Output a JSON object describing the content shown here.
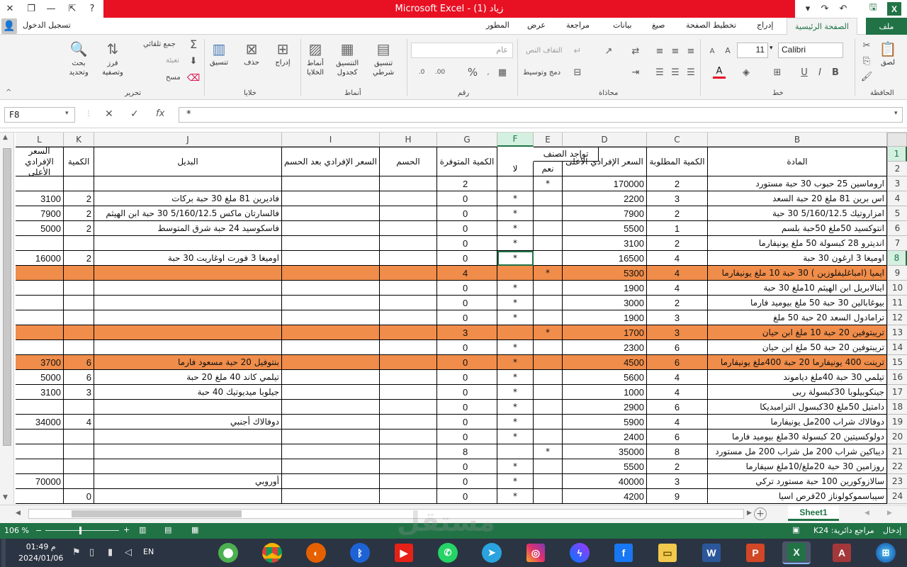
{
  "window": {
    "title": "زياد (1)  -  Microsoft Excel",
    "signin": "تسجيل الدخول"
  },
  "colors": {
    "excel_green": "#217346",
    "title_red": "#e81123",
    "orange_row": "#f08d4a",
    "selection": "#217346"
  },
  "tabs": [
    "ملف",
    "الصفحة الرئيسية",
    "إدراج",
    "تخطيط الصفحة",
    "صيغ",
    "بيانات",
    "مراجعة",
    "عرض",
    "المطور"
  ],
  "ribbon": {
    "clipboard": {
      "group": "الحافظة",
      "paste": "لصق"
    },
    "font": {
      "group": "خط",
      "name": "Calibri",
      "size": "11"
    },
    "alignment": {
      "group": "محاذاة",
      "wrap": "التفاف النص",
      "merge": "دمج وتوسيط"
    },
    "number": {
      "group": "رقم",
      "format": "عام"
    },
    "styles": {
      "group": "أنماط",
      "conditional": "تنسيق\nشرطي",
      "as_table": "التنسيق\nكجدول",
      "cell_styles": "أنماط\nالخلايا"
    },
    "cells": {
      "group": "خلايا",
      "insert": "إدراج",
      "delete": "حذف",
      "format": "تنسيق"
    },
    "editing": {
      "group": "تحرير",
      "autosum": "جمع تلقائي",
      "fill": "تعبئة",
      "clear": "مسح",
      "sort": "فرز\nوتصفية",
      "find": "بحث\nوتحديد"
    }
  },
  "formula_bar": {
    "name_box": "F8",
    "fx": "fx",
    "value": "*"
  },
  "columns": [
    "L",
    "K",
    "J",
    "I",
    "H",
    "G",
    "F",
    "E",
    "D",
    "C",
    "B"
  ],
  "headers": {
    "material": "المادة",
    "qty_required": "الكمية المطلوبة",
    "unit_price_max": "السعر الإفرادي الأعلى",
    "availability": "تواجد الصنف",
    "yes": "نعم",
    "no": "لا",
    "qty_available": "الكمية المتوفرة",
    "discount": "الحسم",
    "price_after_discount": "السعر الإفرادي بعد الحسم",
    "alternative": "البديل",
    "alt_qty": "الكمية",
    "alt_price": "السعر الإفرادي الأعلى"
  },
  "rows": [
    {
      "n": "3",
      "material": "اروماسين 25  حبوب  30 حبة  مستورد",
      "qty": "2",
      "price": "170000",
      "yes": "*",
      "no": "",
      "avail": "2",
      "alt": "",
      "alt_qty": "",
      "alt_price": "",
      "orange": false
    },
    {
      "n": "4",
      "material": "اس برين 81 ملغ  20  حبة  السعد",
      "qty": "3",
      "price": "2200",
      "yes": "",
      "no": "*",
      "avail": "0",
      "alt": "فاديرين 81 ملغ 30 حبة بركات",
      "alt_qty": "2",
      "alt_price": "3100",
      "orange": false
    },
    {
      "n": "5",
      "material": "امزاروتيك 5/160/12.5  30 حبة",
      "qty": "2",
      "price": "7900",
      "yes": "",
      "no": "*",
      "avail": "0",
      "alt": "فالسارتان ماكس 5/160/12.5 30 حبة ابن الهيثم",
      "alt_qty": "2",
      "alt_price": "7900",
      "orange": false
    },
    {
      "n": "6",
      "material": "انتوكسيد 50ملغ 50حبة بلسم",
      "qty": "1",
      "price": "5500",
      "yes": "",
      "no": "*",
      "avail": "0",
      "alt": "فاسكوسيد 24 حبة شرق المتوسط",
      "alt_qty": "2",
      "alt_price": "5000",
      "orange": false
    },
    {
      "n": "7",
      "material": "انديترو 28 كبسولة  50 ملغ  يونيفارما",
      "qty": "2",
      "price": "3100",
      "yes": "",
      "no": "*",
      "avail": "0",
      "alt": "",
      "alt_qty": "",
      "alt_price": "",
      "orange": false
    },
    {
      "n": "8",
      "material": "اوميغا 3 ارغون  30 حبة",
      "qty": "4",
      "price": "16500",
      "yes": "",
      "no": "*",
      "avail": "0",
      "alt": "اوميغا 3 فورت اوغاريت 30 حبة",
      "alt_qty": "2",
      "alt_price": "16000",
      "orange": false
    },
    {
      "n": "9",
      "material": "ايميا (امباغليفلوزين ) 30 حبة 10 ملغ يونيفارما",
      "qty": "4",
      "price": "5300",
      "yes": "*",
      "no": "",
      "avail": "4",
      "alt": "",
      "alt_qty": "",
      "alt_price": "",
      "orange": true
    },
    {
      "n": "10",
      "material": "اينالابريل ابن الهيثم  10ملغ  30 حبة",
      "qty": "4",
      "price": "1900",
      "yes": "",
      "no": "*",
      "avail": "0",
      "alt": "",
      "alt_qty": "",
      "alt_price": "",
      "orange": false
    },
    {
      "n": "11",
      "material": "بيوغابالين 30 حبة  50 ملغ  بيوميد فارما",
      "qty": "2",
      "price": "3000",
      "yes": "",
      "no": "*",
      "avail": "0",
      "alt": "",
      "alt_qty": "",
      "alt_price": "",
      "orange": false
    },
    {
      "n": "12",
      "material": "ترامادول السعد  20 حبة 50 ملغ",
      "qty": "3",
      "price": "1900",
      "yes": "",
      "no": "*",
      "avail": "0",
      "alt": "",
      "alt_qty": "",
      "alt_price": "",
      "orange": false
    },
    {
      "n": "13",
      "material": "تريبتوفين 20 حبة  10 ملغ  ابن حيان",
      "qty": "3",
      "price": "1700",
      "yes": "*",
      "no": "",
      "avail": "3",
      "alt": "",
      "alt_qty": "",
      "alt_price": "",
      "orange": true
    },
    {
      "n": "14",
      "material": "تريبتوفين 20 حبة  50 ملغ  ابن حيان",
      "qty": "6",
      "price": "2300",
      "yes": "",
      "no": "*",
      "avail": "0",
      "alt": "",
      "alt_qty": "",
      "alt_price": "",
      "orange": false
    },
    {
      "n": "15",
      "material": "ترينت 400 يونيفارما 20 حبة 400ملغ يونيفارما",
      "qty": "6",
      "price": "4500",
      "yes": "",
      "no": "*",
      "avail": "0",
      "alt": "بنتوفيل 20 حبة مسعود فارما",
      "alt_qty": "6",
      "alt_price": "3700",
      "orange": true
    },
    {
      "n": "16",
      "material": "تيلمي 30 حبة  40ملغ  دياموند",
      "qty": "4",
      "price": "5600",
      "yes": "",
      "no": "*",
      "avail": "0",
      "alt": "تيلمي كاند 40 ملغ 20 حبة",
      "alt_qty": "6",
      "alt_price": "5000",
      "orange": false
    },
    {
      "n": "17",
      "material": "جينكوبيلوبا  30كبسولة  ربى",
      "qty": "4",
      "price": "1000",
      "yes": "",
      "no": "*",
      "avail": "0",
      "alt": "جيلوبا ميديوتيك 40 حبة",
      "alt_qty": "3",
      "alt_price": "3100",
      "orange": false
    },
    {
      "n": "18",
      "material": "دامتيل  50ملغ  30كبسول  الترامبديكا",
      "qty": "6",
      "price": "2900",
      "yes": "",
      "no": "*",
      "avail": "0",
      "alt": "",
      "alt_qty": "",
      "alt_price": "",
      "orange": false
    },
    {
      "n": "19",
      "material": "دوفالاك شراب 200مل  يونيفارما",
      "qty": "4",
      "price": "5900",
      "yes": "",
      "no": "*",
      "avail": "0",
      "alt": "دوفالاك أجنبي",
      "alt_qty": "4",
      "alt_price": "34000",
      "orange": false
    },
    {
      "n": "20",
      "material": "دولوكسيتين 20 كبسولة 30ملغ بيوميد فارما",
      "qty": "6",
      "price": "2400",
      "yes": "",
      "no": "*",
      "avail": "0",
      "alt": "",
      "alt_qty": "",
      "alt_price": "",
      "orange": false
    },
    {
      "n": "21",
      "material": "ديباكين شراب 200 مل شراب 200 مل مستورد",
      "qty": "8",
      "price": "35000",
      "yes": "*",
      "no": "",
      "avail": "8",
      "alt": "",
      "alt_qty": "",
      "alt_price": "",
      "orange": false
    },
    {
      "n": "22",
      "material": "روزامين 30 حبة  20ملغ/10ملغ سيفارما",
      "qty": "2",
      "price": "5500",
      "yes": "",
      "no": "*",
      "avail": "0",
      "alt": "",
      "alt_qty": "",
      "alt_price": "",
      "orange": false
    },
    {
      "n": "23",
      "material": "سالازوكورين 100 حبة  مستورد  تركي",
      "qty": "3",
      "price": "40000",
      "yes": "",
      "no": "*",
      "avail": "0",
      "alt": "أوروبي",
      "alt_qty": "",
      "alt_price": "70000",
      "orange": false
    },
    {
      "n": "24",
      "material": "سيباسموكولوناز  20قرص  اسيا",
      "qty": "9",
      "price": "4200",
      "yes": "",
      "no": "*",
      "avail": "0",
      "alt": "",
      "alt_qty": "0",
      "alt_price": "",
      "orange": false
    }
  ],
  "sheet_tab": "Sheet1",
  "status": {
    "mode": "إدخال",
    "accessibility": "مراجع دائرية: K24",
    "zoom": "106 %"
  },
  "taskbar": {
    "lang": "EN",
    "time": "01:49 م",
    "date": "2024/01/06"
  },
  "watermark": "مستقل"
}
